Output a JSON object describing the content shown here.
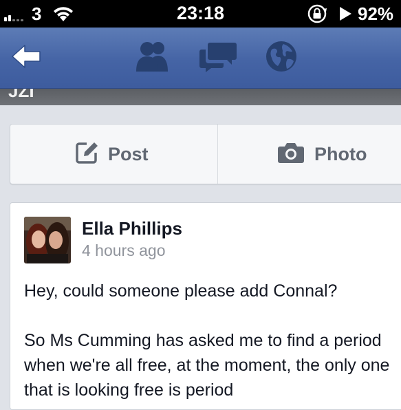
{
  "status_bar": {
    "carrier": "3",
    "time": "23:18",
    "battery": "92%",
    "icons": [
      "signal-icon",
      "wifi-icon",
      "rotation-lock-icon",
      "play-icon"
    ]
  },
  "nav": {
    "icons": [
      "back-arrow-icon",
      "friend-requests-icon",
      "messages-icon",
      "notifications-globe-icon"
    ],
    "background": "#4564a5"
  },
  "sub_strip": {
    "text": "JZI"
  },
  "actions": {
    "post_label": "Post",
    "photo_label": "Photo"
  },
  "story": {
    "author": "Ella Phillips",
    "timestamp": "4 hours ago",
    "paragraphs": [
      "Hey, could someone please add Connal?",
      "So Ms Cumming has asked me to find a period when we're all free, at the moment, the only one that is looking free is period"
    ]
  }
}
